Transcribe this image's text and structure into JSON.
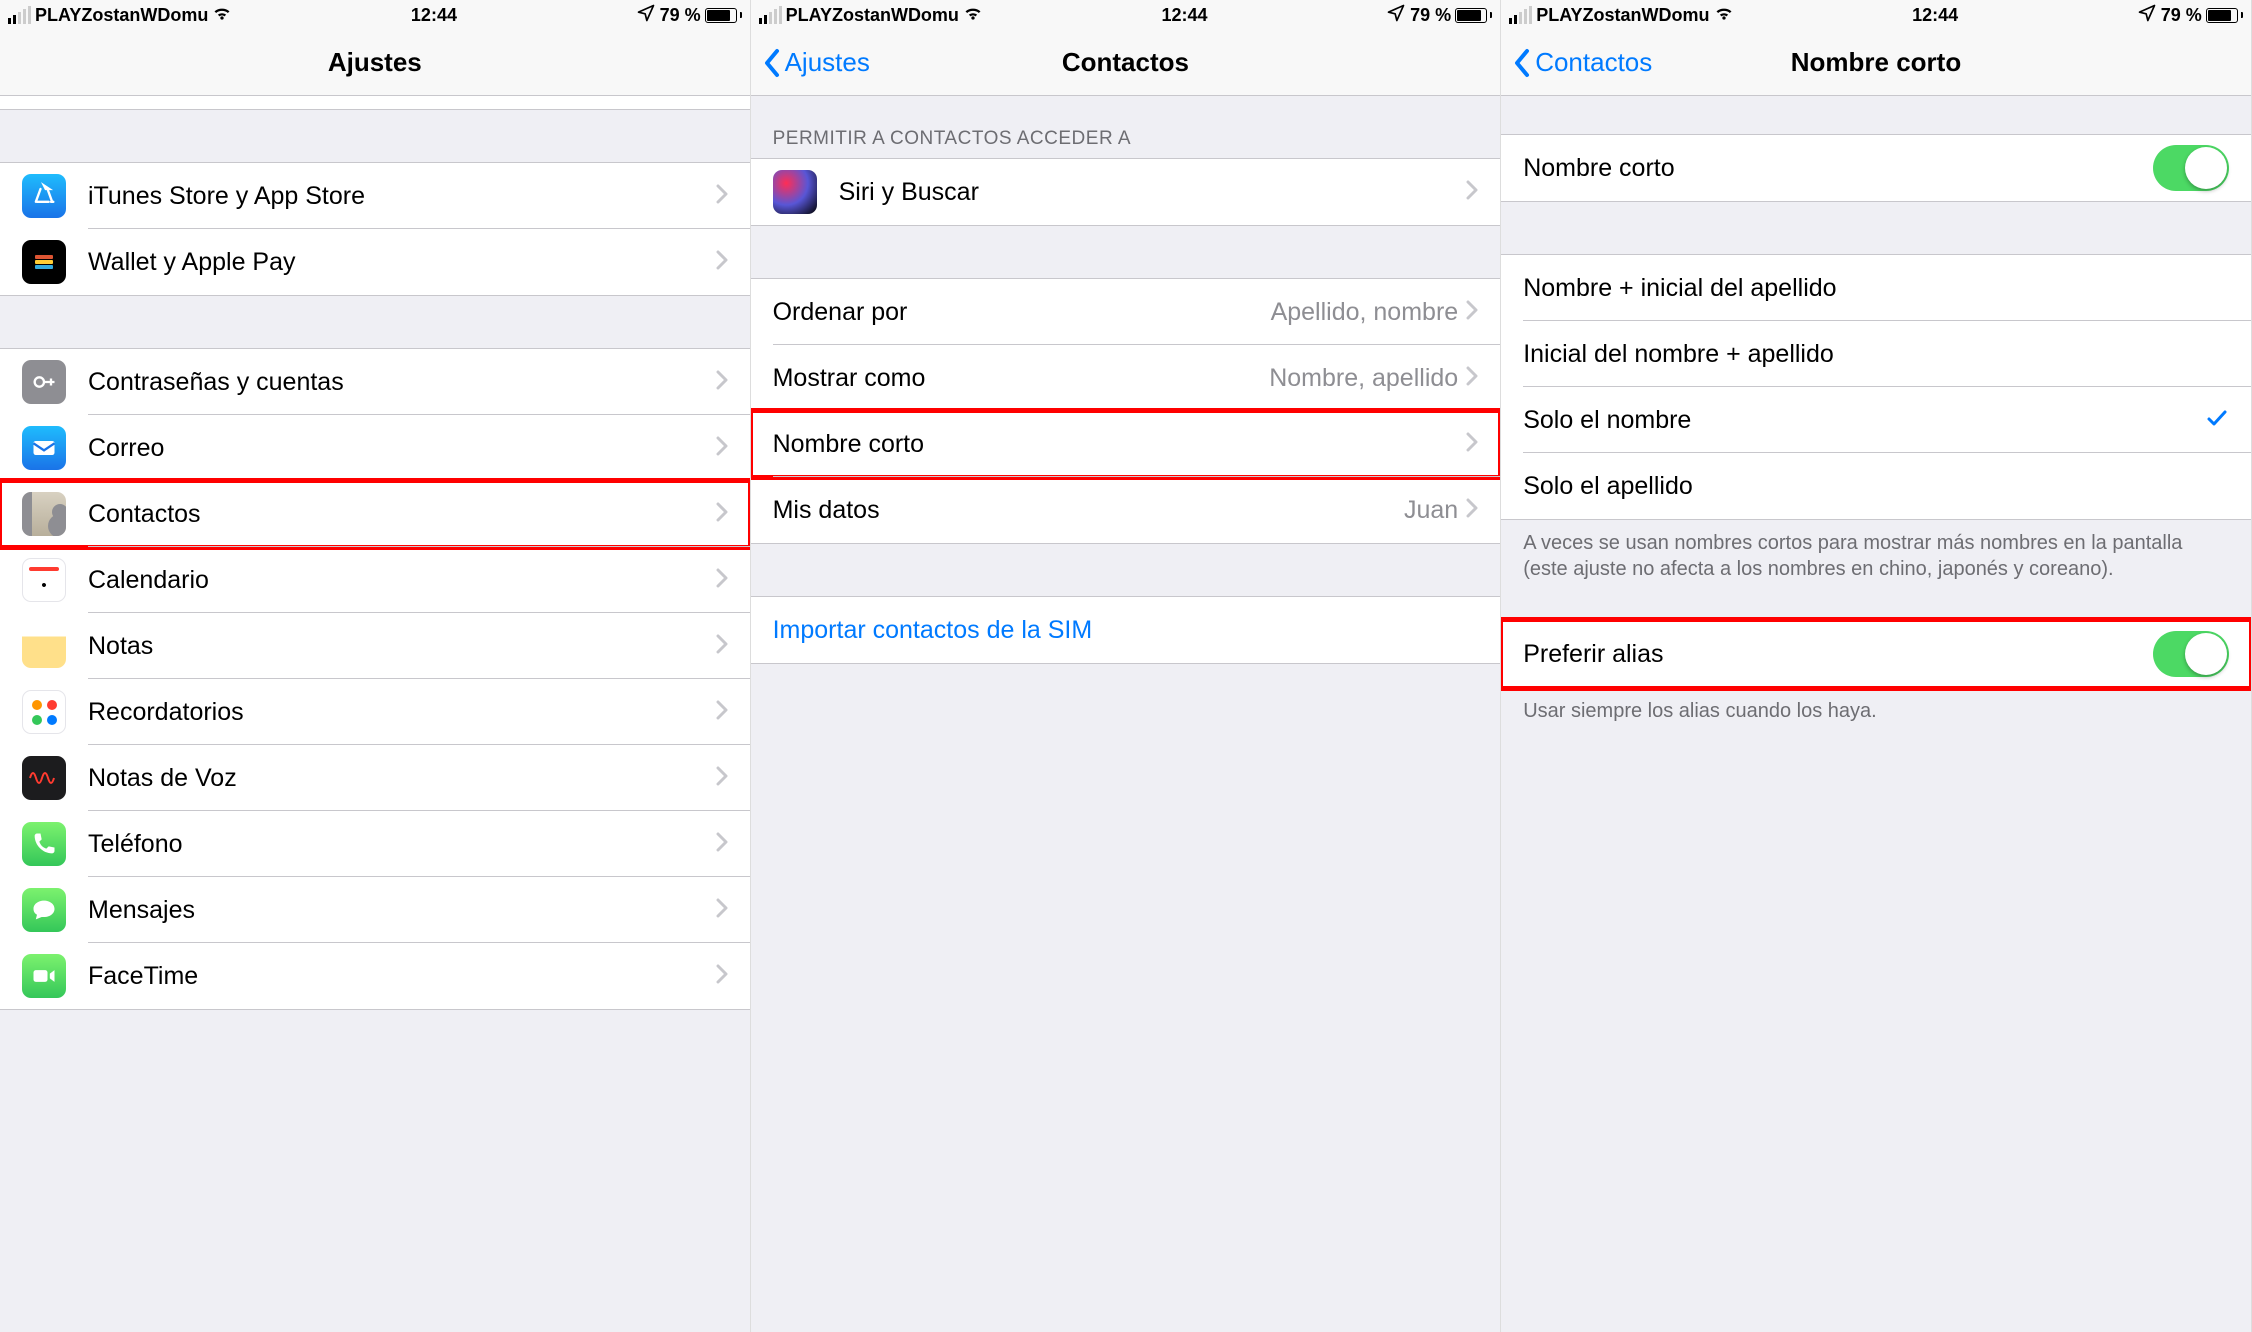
{
  "status": {
    "carrier": "PLAYZostanWDomu",
    "time": "12:44",
    "battery": "79 %"
  },
  "panel1": {
    "title": "Ajustes",
    "rows": {
      "itunes": "iTunes Store y App Store",
      "wallet": "Wallet y Apple Pay",
      "passwords": "Contraseñas y cuentas",
      "mail": "Correo",
      "contacts": "Contactos",
      "calendar": "Calendario",
      "notes": "Notas",
      "reminders": "Recordatorios",
      "voicememos": "Notas de Voz",
      "phone": "Teléfono",
      "messages": "Mensajes",
      "facetime": "FaceTime"
    }
  },
  "panel2": {
    "back": "Ajustes",
    "title": "Contactos",
    "section_header": "Permitir a Contactos acceder a",
    "siri": "Siri y Buscar",
    "sort_by": {
      "label": "Ordenar por",
      "value": "Apellido, nombre"
    },
    "display_as": {
      "label": "Mostrar como",
      "value": "Nombre, apellido"
    },
    "short_name": "Nombre corto",
    "my_info": {
      "label": "Mis datos",
      "value": "Juan"
    },
    "import_sim": "Importar contactos de la SIM"
  },
  "panel3": {
    "back": "Contactos",
    "title": "Nombre corto",
    "short_name_toggle": "Nombre corto",
    "options": {
      "first_last_initial": "Nombre + inicial del apellido",
      "last_initial_first": "Inicial del nombre + apellido",
      "first_only": "Solo el nombre",
      "last_only": "Solo el apellido"
    },
    "footer1": "A veces se usan nombres cortos para mostrar más nombres en la pantalla (este ajuste no afecta a los nombres en chino, japonés y coreano).",
    "prefer_nicknames": "Preferir alias",
    "footer2": "Usar siempre los alias cuando los haya."
  }
}
